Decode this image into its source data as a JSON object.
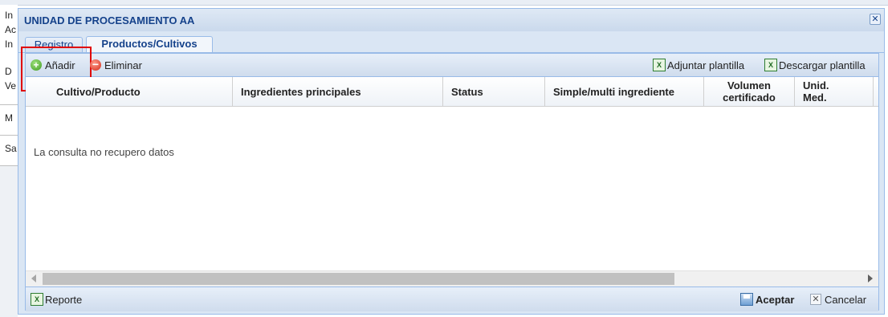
{
  "background": {
    "letters": [
      "In",
      "Ac",
      "In",
      "D",
      "Ve",
      "M",
      "Sa"
    ]
  },
  "window": {
    "title": "UNIDAD DE PROCESAMIENTO AA",
    "close_glyph": "✕"
  },
  "tabs": [
    {
      "label": "Registro",
      "active": false
    },
    {
      "label": "Productos/Cultivos",
      "active": true
    }
  ],
  "toolbar": {
    "add_label": "Añadir",
    "delete_label": "Eliminar",
    "attach_template_label": "Adjuntar plantilla",
    "download_template_label": "Descargar plantilla"
  },
  "grid": {
    "columns": [
      "Cultivo/Producto",
      "Ingredientes principales",
      "Status",
      "Simple/multi ingrediente",
      "Volumen certificado",
      "Unid. Med."
    ],
    "empty_message": "La consulta no recupero datos"
  },
  "footer": {
    "report_label": "Reporte",
    "accept_label": "Aceptar",
    "cancel_label": "Cancelar"
  },
  "icons": {
    "add": "add-circle-icon",
    "delete": "remove-circle-icon",
    "excel": "excel-icon",
    "save": "floppy-disk-icon",
    "cancel": "close-icon"
  },
  "colors": {
    "accent": "#15428b",
    "border": "#99bbe8",
    "highlight": "#e00000"
  }
}
